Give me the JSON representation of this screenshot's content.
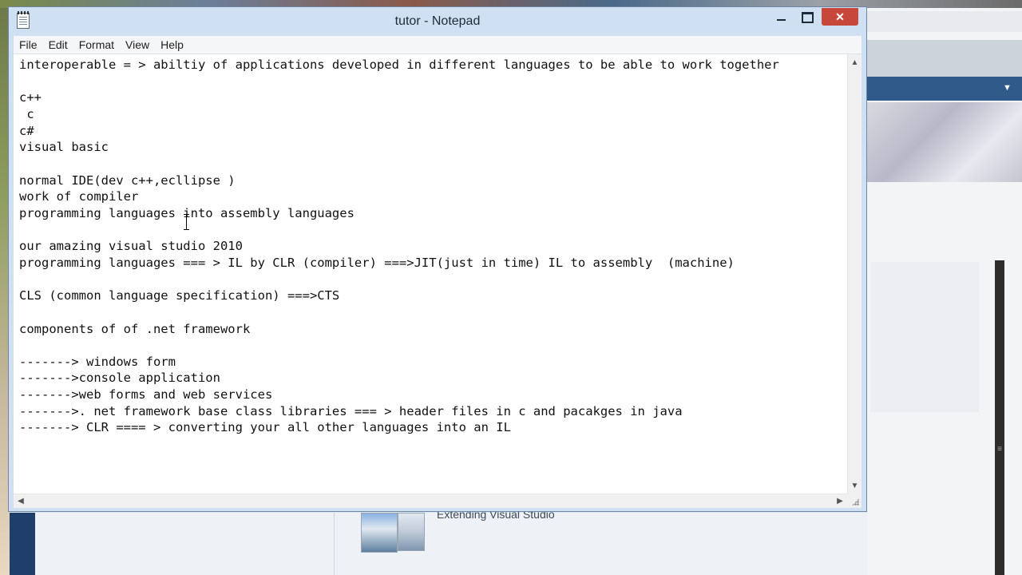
{
  "window": {
    "title": "tutor - Notepad",
    "close_glyph": "✕"
  },
  "menu": {
    "items": [
      "File",
      "Edit",
      "Format",
      "View",
      "Help"
    ]
  },
  "editor": {
    "text": "interoperable = > abiltiy of applications developed in different languages to be able to work together\n\nc++\n c\nc#\nvisual basic\n\nnormal IDE(dev c++,ecllipse )\nwork of compiler\nprogramming languages into assembly languages\n\nour amazing visual studio 2010\nprogramming languages === > IL by CLR (compiler) ===>JIT(just in time) IL to assembly  (machine)\n\nCLS (common language specification) ===>CTS\n\ncomponents of of .net framework\n\n-------> windows form\n------->console application\n------->web forms and web services\n------->. net framework base class libraries === > header files in c and pacakges in java\n-------> CLR ==== > converting your all other languages into an IL"
  },
  "background": {
    "extending_text": "Extending Visual Studio",
    "dropdown_glyph": "▼",
    "scroll_grip_glyph": "≡"
  },
  "icons": {
    "scroll_up": "▲",
    "scroll_down": "▼",
    "scroll_left": "◀",
    "scroll_right": "▶"
  },
  "colors": {
    "title_bar": "#cfe0f3",
    "close_button": "#c7473a",
    "editor_background": "#ffffff"
  }
}
